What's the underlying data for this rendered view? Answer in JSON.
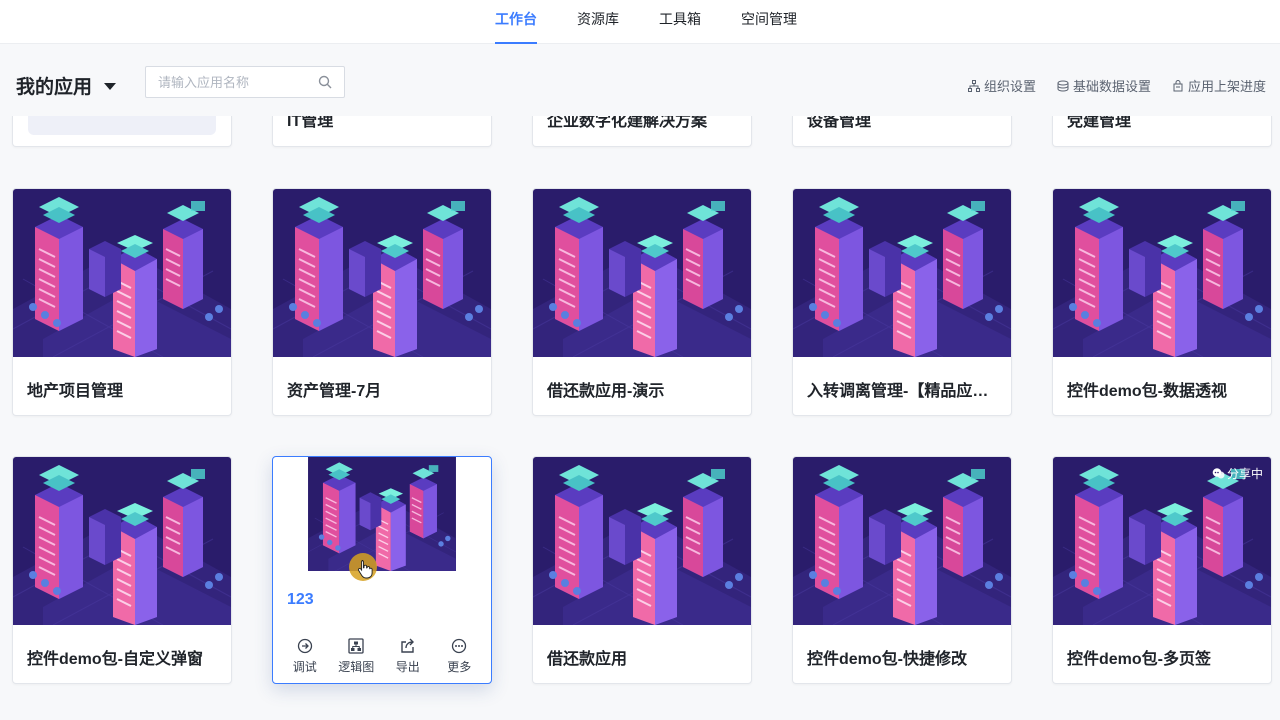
{
  "topnav": {
    "tabs": [
      {
        "label": "工作台",
        "active": true
      },
      {
        "label": "资源库",
        "active": false
      },
      {
        "label": "工具箱",
        "active": false
      },
      {
        "label": "空间管理",
        "active": false
      }
    ]
  },
  "header": {
    "title": "我的应用",
    "search_placeholder": "请输入应用名称",
    "links": [
      {
        "label": "组织设置",
        "icon": "org-icon"
      },
      {
        "label": "基础数据设置",
        "icon": "database-icon"
      },
      {
        "label": "应用上架进度",
        "icon": "shelf-icon"
      }
    ]
  },
  "apps": {
    "top_partial": [
      "",
      "IT管理",
      "企业数字化建解决方案",
      "设备管理",
      "党建管理"
    ],
    "row1": [
      {
        "name": "地产项目管理"
      },
      {
        "name": "资产管理-7月"
      },
      {
        "name": "借还款应用-演示"
      },
      {
        "name": "入转调离管理-【精品应用】"
      },
      {
        "name": "控件demo包-数据透视"
      }
    ],
    "row2": [
      {
        "name": "控件demo包-自定义弹窗"
      },
      {
        "name": "123",
        "hovered": true
      },
      {
        "name": "借还款应用"
      },
      {
        "name": "控件demo包-快捷修改"
      },
      {
        "name": "控件demo包-多页签",
        "badge": "分享中"
      }
    ]
  },
  "hover_actions": [
    {
      "label": "调试",
      "icon": "debug-icon"
    },
    {
      "label": "逻辑图",
      "icon": "logic-diagram-icon"
    },
    {
      "label": "导出",
      "icon": "export-icon"
    },
    {
      "label": "更多",
      "icon": "more-icon"
    }
  ],
  "colors": {
    "accent": "#3b7cff",
    "thumb_bg": "#2b1d6e"
  }
}
